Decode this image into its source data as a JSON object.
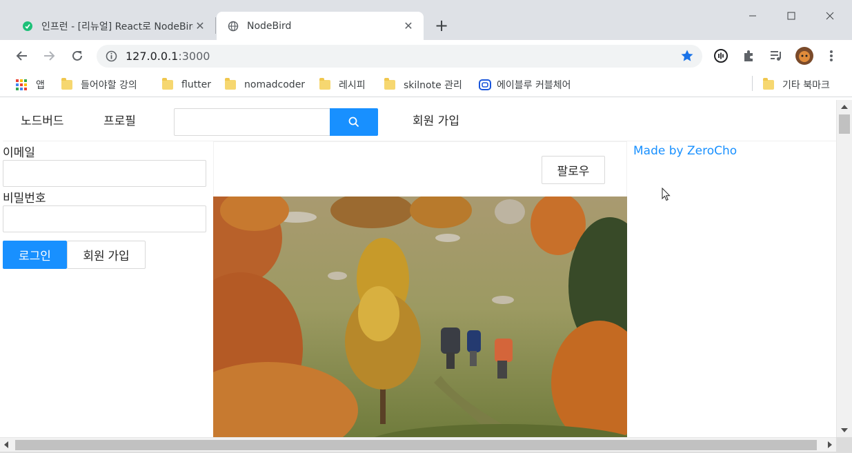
{
  "browser": {
    "tabs": [
      {
        "title": "인프런 - [리뉴얼] React로 NodeBird",
        "active": false,
        "favicon": "inflearn-icon"
      },
      {
        "title": "NodeBird",
        "active": true,
        "favicon": "globe-icon"
      }
    ],
    "new_tab_label": "+",
    "url_host": "127.0.0.1",
    "url_port": ":3000",
    "accent_color": "#1a73e8",
    "bookmarks": [
      {
        "label": "앱",
        "icon": "apps-grid-icon"
      },
      {
        "label": "들어야할 강의",
        "icon": "folder-icon"
      },
      {
        "label": "flutter",
        "icon": "folder-icon"
      },
      {
        "label": "nomadcoder",
        "icon": "folder-icon"
      },
      {
        "label": "레시피",
        "icon": "folder-icon"
      },
      {
        "label": "skilnote 관리",
        "icon": "folder-icon"
      },
      {
        "label": "에이블루 커블체어",
        "icon": "ablue-icon"
      },
      {
        "label": "기타 북마크",
        "icon": "folder-icon"
      }
    ]
  },
  "nav": {
    "items": [
      "노드버드",
      "프로필"
    ],
    "signup": "회원 가입",
    "search_value": "",
    "search_icon": "search-icon"
  },
  "login": {
    "email_label": "이메일",
    "email_value": "",
    "password_label": "비밀번호",
    "password_value": "",
    "login_button": "로그인",
    "signup_button": "회원 가입"
  },
  "post": {
    "follow_button": "팔로우",
    "image": "autumn-hikers-photo"
  },
  "footer": {
    "made_by": "Made by ZeroCho"
  },
  "theme": {
    "primary": "#1890ff",
    "border": "#d9d9d9"
  }
}
